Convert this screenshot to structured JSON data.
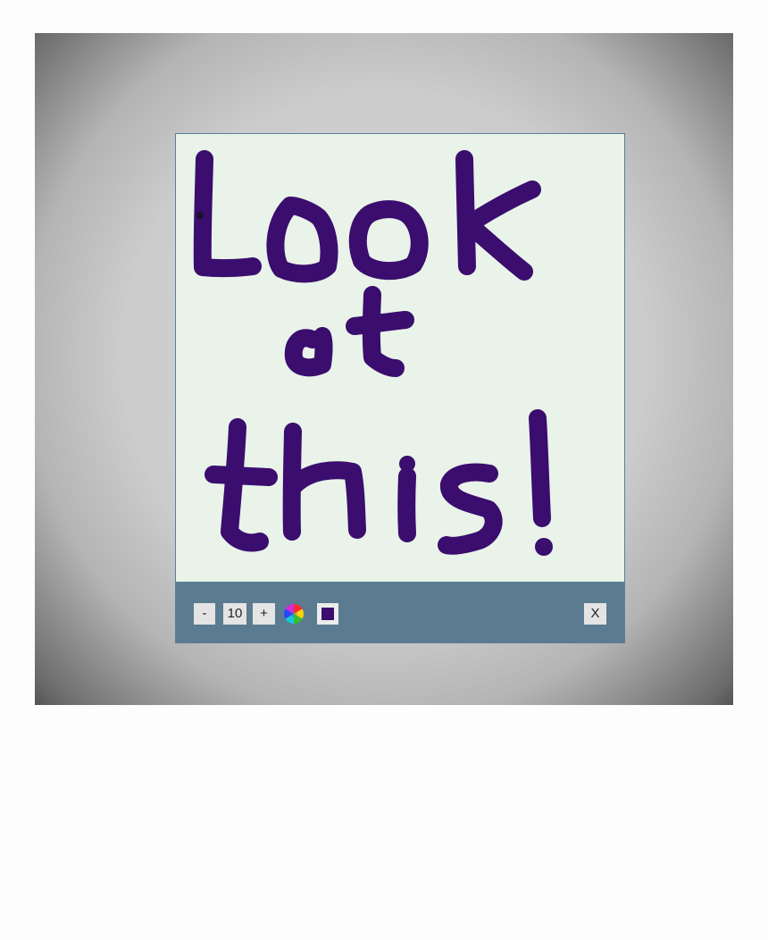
{
  "drawing": {
    "text": "Look at this!",
    "brush_color": "#3a0d6e",
    "canvas_color": "#e9f3e9"
  },
  "toolbar": {
    "decrease_label": "-",
    "brush_size": "10",
    "increase_label": "+",
    "color_picker_icon": "color-wheel-icon",
    "current_color": "#3a0d6e",
    "close_label": "X"
  }
}
